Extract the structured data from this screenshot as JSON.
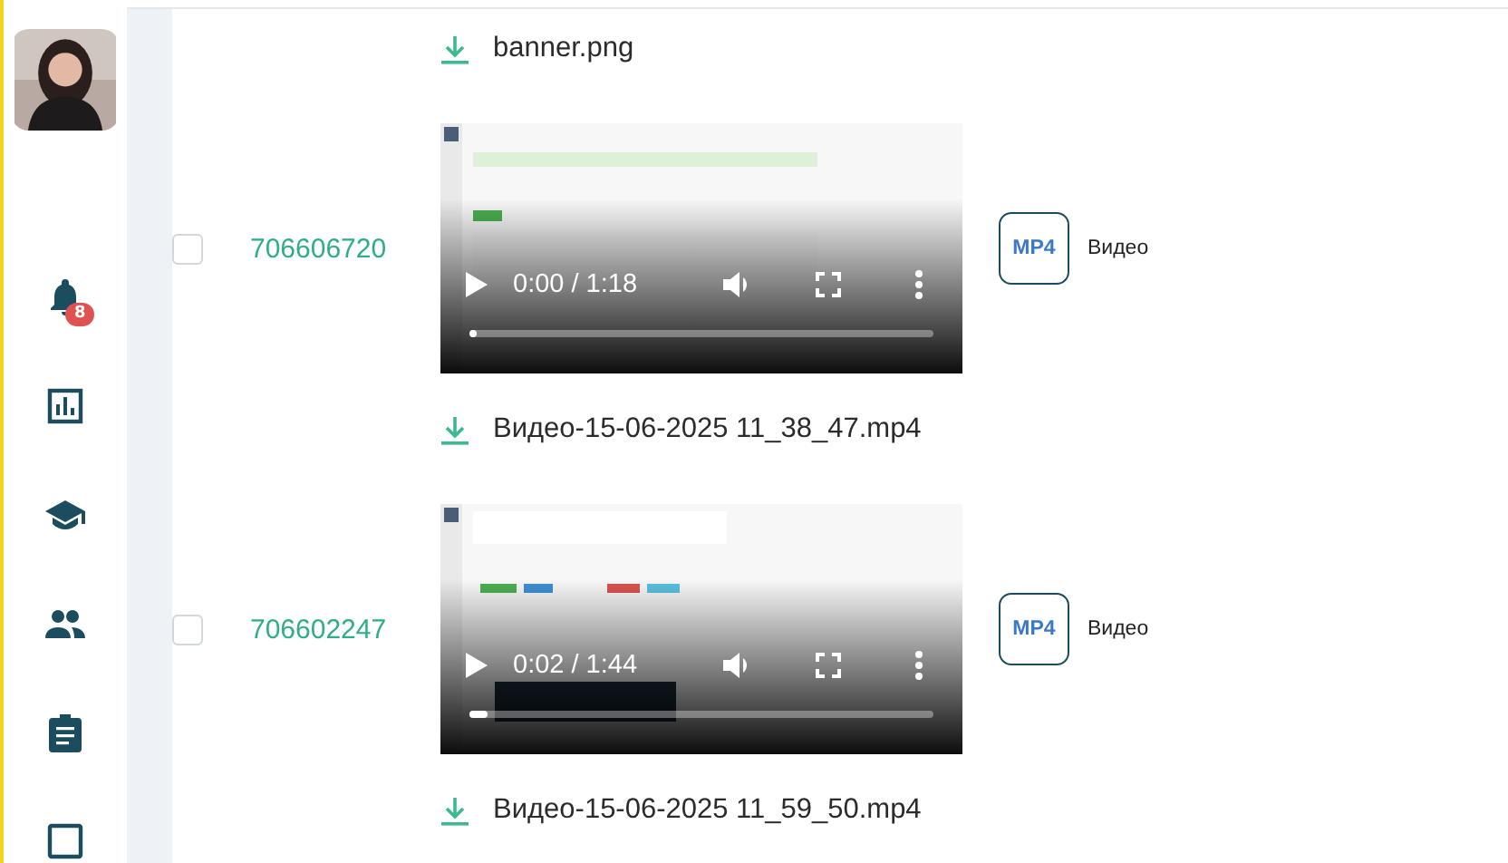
{
  "sidebar": {
    "items": [
      {
        "kind": "bell",
        "badge": "8"
      },
      {
        "kind": "chart"
      },
      {
        "kind": "cap"
      },
      {
        "kind": "people"
      },
      {
        "kind": "clipboard"
      },
      {
        "kind": "square"
      }
    ]
  },
  "top_file": {
    "name": "banner.png"
  },
  "rows": [
    {
      "id": "706606720",
      "checked": false,
      "video": {
        "time": "0:00 / 1:18",
        "level": 0.01
      },
      "file_name": "Видео-15-06-2025 11_38_47.mp4",
      "format": "MP4",
      "type_label": "Видео"
    },
    {
      "id": "706602247",
      "checked": false,
      "video": {
        "time": "0:02 / 1:44",
        "level": 0.04
      },
      "file_name": "Видео-15-06-2025 11_59_50.mp4",
      "format": "MP4",
      "type_label": "Видео"
    }
  ]
}
